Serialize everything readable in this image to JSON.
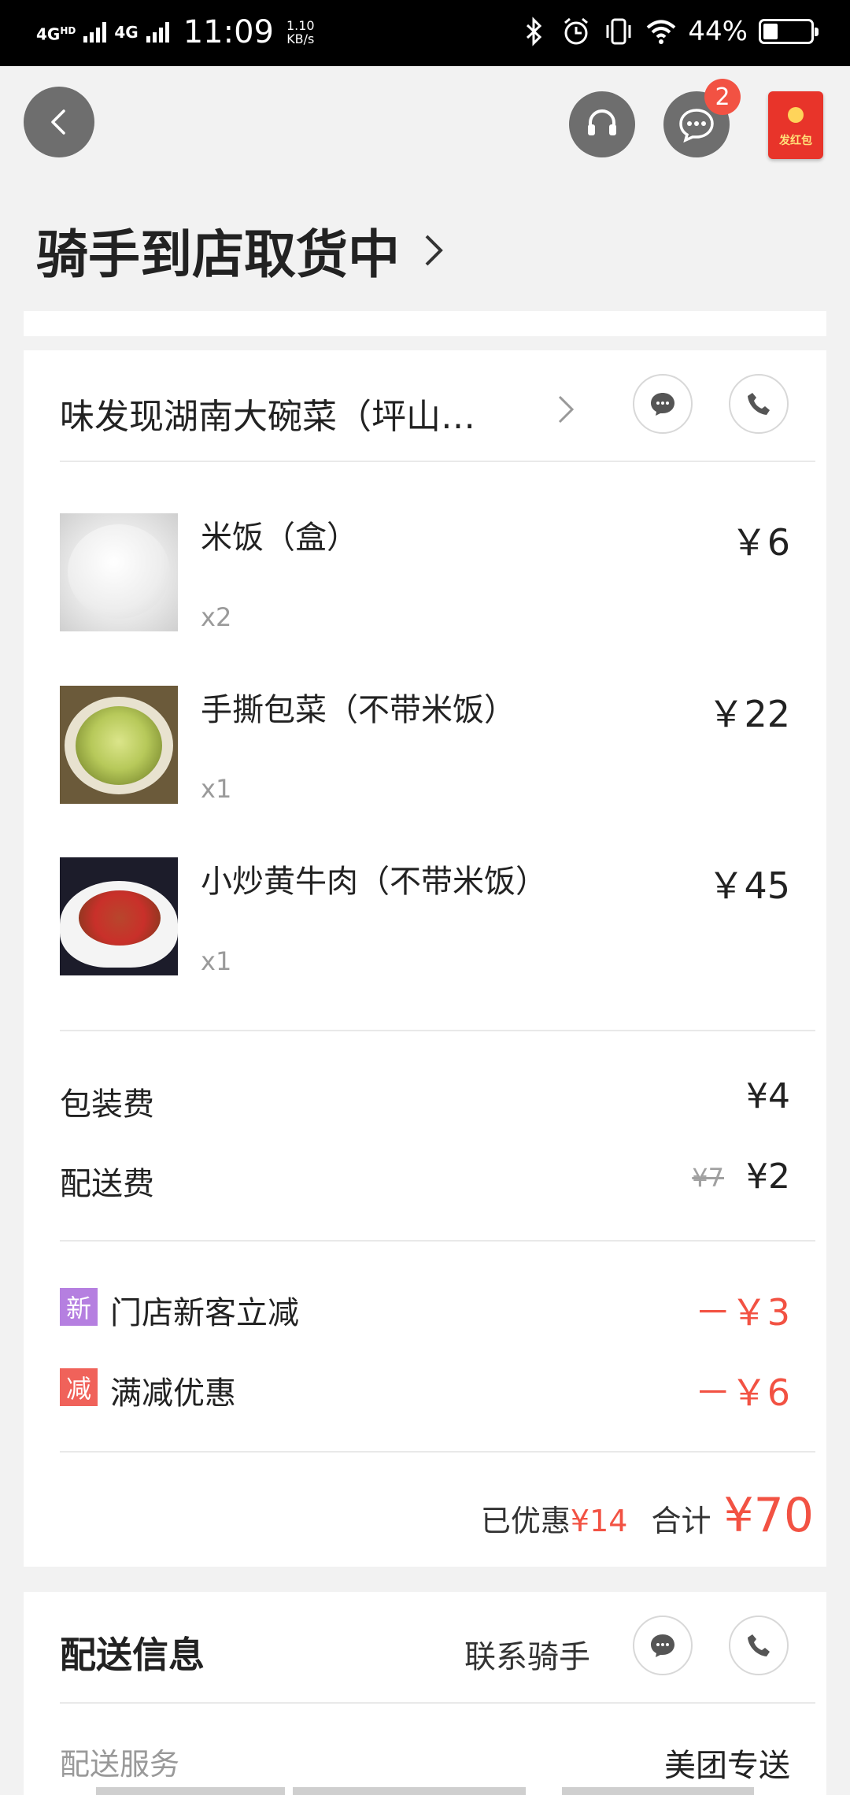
{
  "status_bar": {
    "network1": "4G",
    "network1_sup": "HD",
    "network2": "4G",
    "time": "11:09",
    "speed_value": "1.10",
    "speed_unit": "KB/s",
    "battery": "44%",
    "battery_level": 0.44
  },
  "header": {
    "message_badge": "2",
    "red_packet_label": "发红包"
  },
  "order_status": {
    "title": "骑手到店取货中",
    "chevron": "›"
  },
  "store": {
    "name": "味发现湖南大碗菜（坪山…"
  },
  "items": [
    {
      "name": "米饭（盒）",
      "qty": "x2",
      "price": "￥6"
    },
    {
      "name": "手撕包菜（不带米饭）",
      "qty": "x1",
      "price": "￥22"
    },
    {
      "name": "小炒黄牛肉（不带米饭）",
      "qty": "x1",
      "price": "￥45"
    }
  ],
  "fees": {
    "packaging_label": "包装费",
    "packaging_value": "¥4",
    "delivery_label": "配送费",
    "delivery_original": "¥7",
    "delivery_value": "¥2"
  },
  "discounts": [
    {
      "tag": "新",
      "tag_color": "#b57fe0",
      "label": "门店新客立减",
      "value": "－￥3"
    },
    {
      "tag": "减",
      "tag_color": "#f0625a",
      "label": "满减优惠",
      "value": "－￥6"
    }
  ],
  "summary": {
    "saved_label": "已优惠",
    "saved_amount": "¥14",
    "total_label": "合计",
    "total_amount": "¥70"
  },
  "delivery": {
    "title": "配送信息",
    "contact_label": "联系骑手",
    "service_label": "配送服务",
    "service_value": "美团专送"
  },
  "colors": {
    "accent_red": "#f25243",
    "new_tag": "#b57fe0",
    "discount_tag": "#f0625a"
  }
}
